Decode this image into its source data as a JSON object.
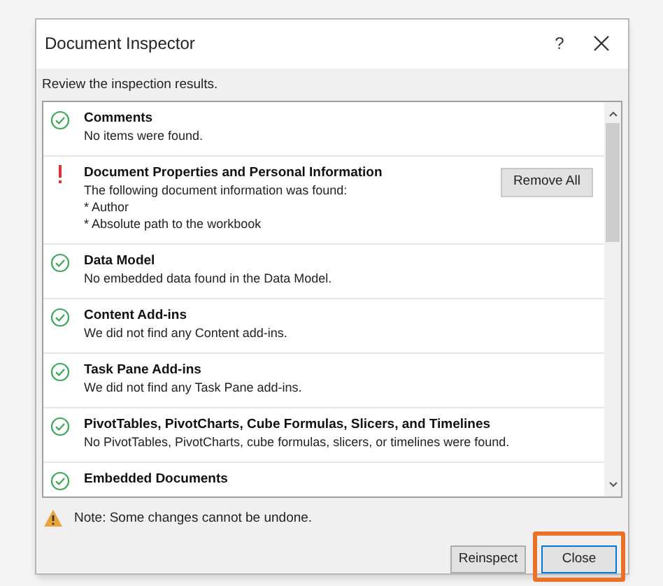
{
  "window": {
    "title": "Document Inspector",
    "help": "?"
  },
  "instruction": "Review the inspection results.",
  "results": [
    {
      "kind": "ok",
      "title": "Comments",
      "lines": [
        "No items were found."
      ]
    },
    {
      "kind": "issue",
      "title": "Document Properties and Personal Information",
      "lines": [
        "The following document information was found:",
        "* Author",
        "* Absolute path to the workbook"
      ],
      "action": "Remove All"
    },
    {
      "kind": "ok",
      "title": "Data Model",
      "lines": [
        "No embedded data found in the Data Model."
      ]
    },
    {
      "kind": "ok",
      "title": "Content Add-ins",
      "lines": [
        "We did not find any Content add-ins."
      ]
    },
    {
      "kind": "ok",
      "title": "Task Pane Add-ins",
      "lines": [
        "We did not find any Task Pane add-ins."
      ]
    },
    {
      "kind": "ok",
      "title": "PivotTables, PivotCharts, Cube Formulas, Slicers, and Timelines",
      "lines": [
        "No PivotTables, PivotCharts, cube formulas, slicers, or timelines were found."
      ]
    },
    {
      "kind": "ok",
      "title": "Embedded Documents"
    }
  ],
  "note": "Note: Some changes cannot be undone.",
  "buttons": [
    {
      "label": "Reinspect",
      "highlighted": false
    },
    {
      "label": "Close",
      "highlighted": true
    }
  ]
}
